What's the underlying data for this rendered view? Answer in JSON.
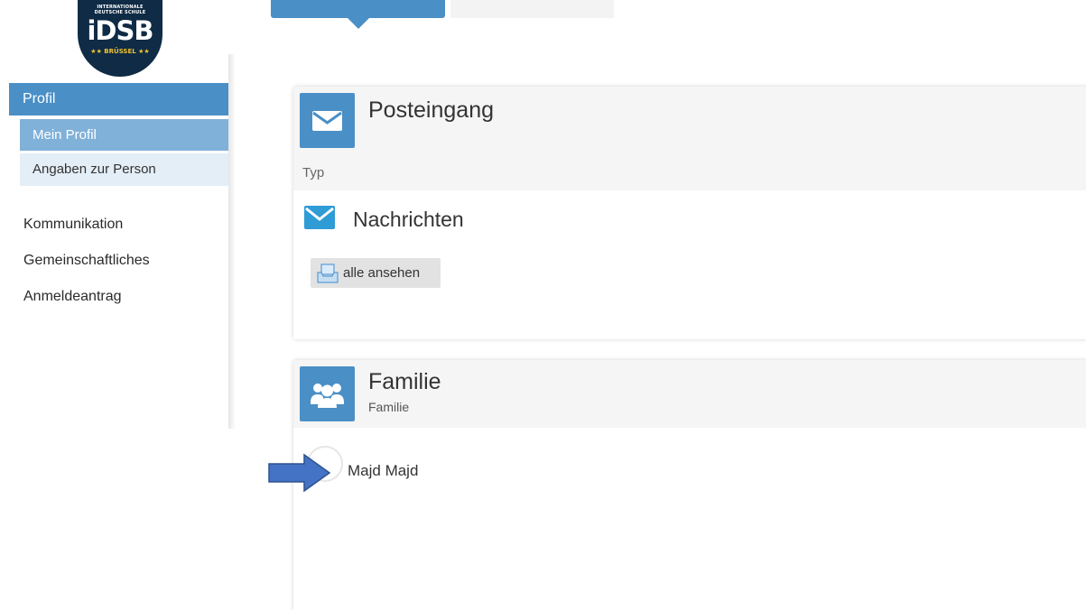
{
  "logo": {
    "top_text": "INTERNATIONALE\nDEUTSCHE SCHULE",
    "main_text": "iDSB",
    "bottom_text": "★★ BRÜSSEL ★★"
  },
  "sidebar": {
    "section": "Profil",
    "sub_items": [
      {
        "label": "Mein Profil",
        "active": true
      },
      {
        "label": "Angaben zur Person",
        "active": false
      }
    ],
    "items": [
      {
        "label": "Kommunikation"
      },
      {
        "label": "Gemeinschaftliches"
      },
      {
        "label": "Anmeldeantrag"
      }
    ]
  },
  "inbox_card": {
    "title": "Posteingang",
    "icon": "envelope-icon",
    "column_label": "Typ",
    "row_label": "Nachrichten",
    "row_icon": "envelope-icon",
    "button_label": "alle ansehen",
    "button_icon": "inbox-tray-icon"
  },
  "family_card": {
    "title": "Familie",
    "subtitle": "Familie",
    "icon": "people-group-icon",
    "members": [
      {
        "name": "Majd Majd"
      }
    ]
  },
  "colors": {
    "accent": "#4a8fc6",
    "accent_light": "#80b1d9",
    "sub_item_bg": "#e4eef7",
    "logo_bg": "#0f2b45",
    "annotation_arrow": "#4472c4"
  }
}
